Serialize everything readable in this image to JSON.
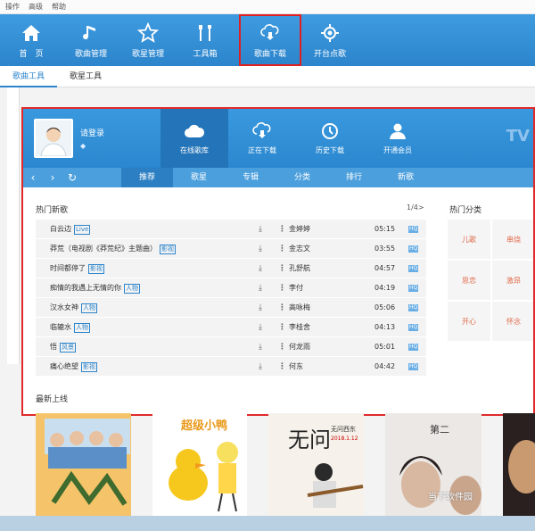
{
  "menubar": [
    "操作",
    "高级",
    "帮助"
  ],
  "toolbar": [
    {
      "label": "首　页",
      "icon": "home-icon"
    },
    {
      "label": "歌曲管理",
      "icon": "music-note-icon"
    },
    {
      "label": "歌星管理",
      "icon": "star-icon"
    },
    {
      "label": "工具箱",
      "icon": "tools-icon"
    },
    {
      "label": "歌曲下载",
      "icon": "cloud-download-icon",
      "active": true
    },
    {
      "label": "开台点歌",
      "icon": "crosshair-icon"
    }
  ],
  "subtabs": [
    "歌曲工具",
    "歌星工具"
  ],
  "panel": {
    "login": "请登录",
    "nav": [
      "在线歌库",
      "正在下载",
      "历史下载",
      "开通会员"
    ],
    "logo": "TV",
    "tabs": [
      "推荐",
      "歌星",
      "专辑",
      "分类",
      "排行",
      "新歌"
    ],
    "section_new": "热门新歌",
    "pager": "1/4>",
    "section_cats": "热门分类",
    "songs": [
      {
        "name": "白云边",
        "tag": "Live",
        "singer": "金婷婷",
        "duration": "05:15"
      },
      {
        "name": "莽荒（电视剧《莽荒纪》主题曲）",
        "tag": "影视",
        "singer": "金志文",
        "duration": "03:55"
      },
      {
        "name": "时间都停了",
        "tag": "影视",
        "singer": "孔舒航",
        "duration": "04:57"
      },
      {
        "name": "痴情的我遇上无情的你",
        "tag": "人物",
        "singer": "李付",
        "duration": "04:19"
      },
      {
        "name": "汉水女神",
        "tag": "人物",
        "singer": "高咏梅",
        "duration": "05:06"
      },
      {
        "name": "临辘水",
        "tag": "人物",
        "singer": "李桂舍",
        "duration": "04:13"
      },
      {
        "name": "悟",
        "tag": "风景",
        "singer": "何龙雨",
        "duration": "05:01"
      },
      {
        "name": "痛心绝望",
        "tag": "影视",
        "singer": "何东",
        "duration": "04:42"
      }
    ],
    "hq": "HQ",
    "categories": [
      [
        "儿歌",
        "串烧"
      ],
      [
        "思恋",
        "激昂"
      ],
      [
        "开心",
        "怀念"
      ]
    ],
    "section_latest": "最新上线"
  },
  "posters": {
    "p2_text": "超级小鸭",
    "p3_title": "无问",
    "p3_sub": "无问西东",
    "p3_date": "2018.1.12",
    "p4_text": "第二"
  },
  "watermark": "当下软件园"
}
